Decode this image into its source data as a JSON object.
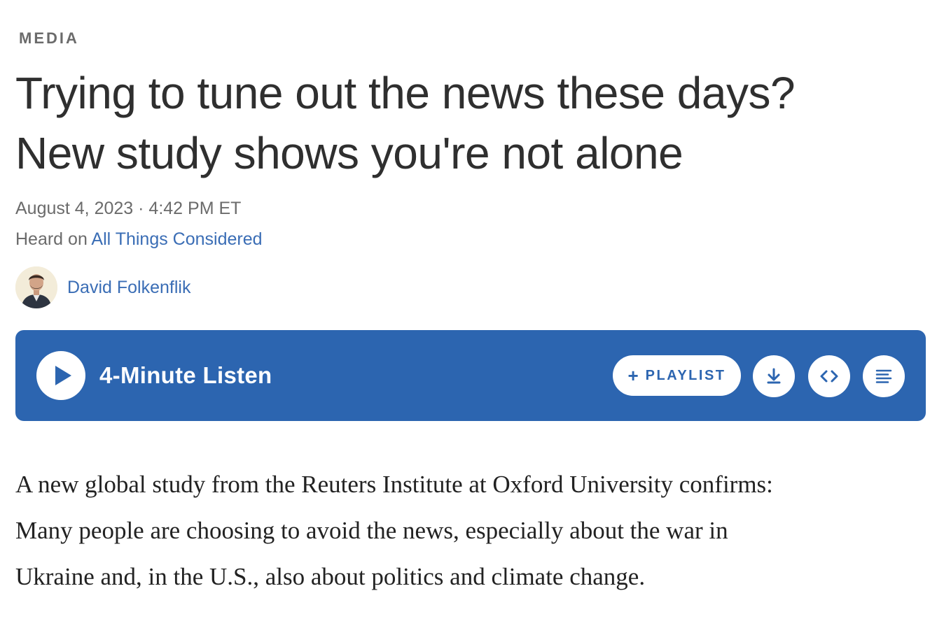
{
  "article": {
    "section": "MEDIA",
    "headline_lines": [
      "Trying to tune out the news these days?",
      "New study shows you're not alone"
    ],
    "date": "August 4, 2023",
    "separator": " · ",
    "time": "4:42 PM ET",
    "heard_prefix": "Heard on ",
    "program": "All Things Considered",
    "author": "David Folkenflik",
    "body_lines": [
      "A new global study from the Reuters Institute at Oxford University confirms:",
      "Many people are choosing to avoid the news, especially about the war in",
      "Ukraine and, in the U.S., also about politics and climate change."
    ]
  },
  "player": {
    "listen_label": "4-Minute Listen",
    "playlist_plus": "+",
    "playlist_label": "PLAYLIST",
    "icons": {
      "play": "play-icon",
      "download": "download-icon",
      "embed": "embed-icon",
      "transcript": "transcript-icon"
    }
  },
  "colors": {
    "player_bg": "#2c65b0",
    "link": "#3a6db5",
    "headline": "#2f2f2f",
    "meta": "#6b6b6b"
  }
}
